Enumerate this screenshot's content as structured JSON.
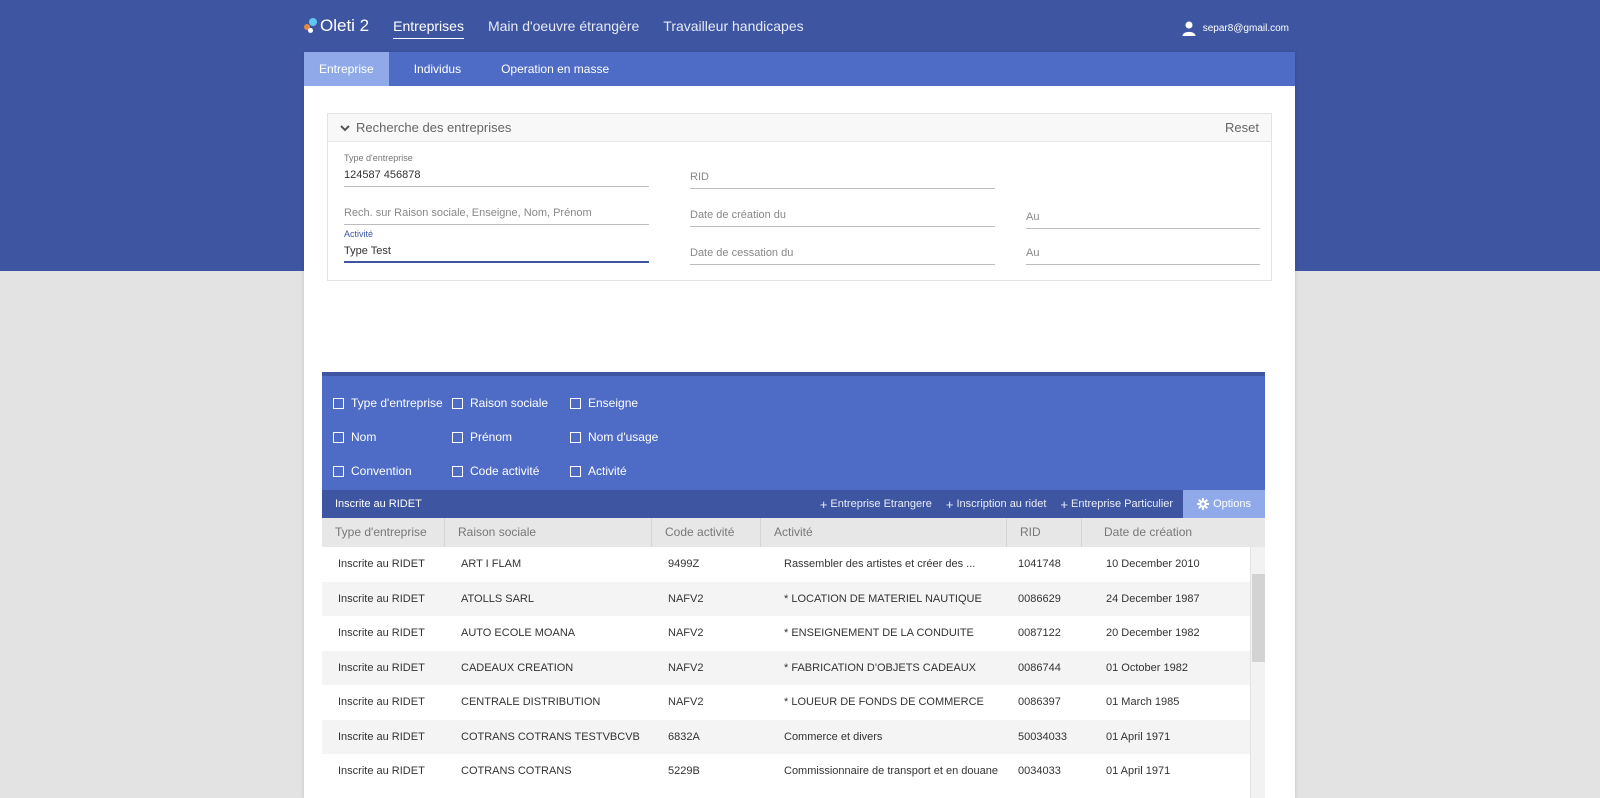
{
  "app": {
    "brand": "Oleti 2",
    "user_email": "separ8@gmail.com"
  },
  "topnav": [
    {
      "label": "Entreprises",
      "active": true
    },
    {
      "label": "Main d'oeuvre étrangère",
      "active": false
    },
    {
      "label": "Travailleur handicapes",
      "active": false
    }
  ],
  "subnav": [
    {
      "label": "Entreprise",
      "active": true
    },
    {
      "label": "Individus",
      "active": false
    },
    {
      "label": "Operation en masse",
      "active": false
    }
  ],
  "search": {
    "title": "Recherche des entreprises",
    "reset_label": "Reset",
    "type_label": "Type d'entreprise",
    "type_value": "124587 456878",
    "rid_placeholder": "RID",
    "rech_placeholder": "Rech. sur Raison sociale, Enseigne, Nom, Prénom",
    "date_creation_placeholder": "Date de création du",
    "au1_placeholder": "Au",
    "activite_label": "Activité",
    "activite_value": "Type Test",
    "date_cessation_placeholder": "Date de cessation du",
    "au2_placeholder": "Au"
  },
  "columns_panel": {
    "options": [
      "Type d'entreprise",
      "Raison sociale",
      "Enseigne",
      "Nom",
      "Prénom",
      "Nom d'usage",
      "Convention",
      "Code activité",
      "Activité"
    ]
  },
  "grid": {
    "title": "Inscrite au RIDET",
    "buttons": [
      "Entreprise Etrangere",
      "Inscription au ridet",
      "Entreprise Particulier"
    ],
    "options_label": "Options",
    "headers": [
      "Type d'entreprise",
      "Raison sociale",
      "Code activité",
      "Activité",
      "RID",
      "Date de création"
    ],
    "rows": [
      [
        "Inscrite au RIDET",
        "ART I FLAM",
        "9499Z",
        "Rassembler des artistes et créer des ...",
        "1041748",
        "10 December 2010"
      ],
      [
        "Inscrite au RIDET",
        "ATOLLS SARL",
        "NAFV2",
        "* LOCATION DE MATERIEL NAUTIQUE",
        "0086629",
        "24 December 1987"
      ],
      [
        "Inscrite au RIDET",
        "AUTO ECOLE MOANA",
        "NAFV2",
        "* ENSEIGNEMENT DE LA CONDUITE",
        "0087122",
        "20 December 1982"
      ],
      [
        "Inscrite au RIDET",
        "CADEAUX CREATION",
        "NAFV2",
        "* FABRICATION D'OBJETS CADEAUX",
        "0086744",
        "01 October 1982"
      ],
      [
        "Inscrite au RIDET",
        "CENTRALE DISTRIBUTION",
        "NAFV2",
        "* LOUEUR DE FONDS DE COMMERCE",
        "0086397",
        "01 March 1985"
      ],
      [
        "Inscrite au RIDET",
        "COTRANS COTRANS TESTVBCVB",
        "6832A",
        "Commerce et divers",
        "50034033",
        "01 April 1971"
      ],
      [
        "Inscrite au RIDET",
        "COTRANS COTRANS",
        "5229B",
        "Commissionnaire de transport et en douane",
        "0034033",
        "01 April 1971"
      ]
    ]
  }
}
